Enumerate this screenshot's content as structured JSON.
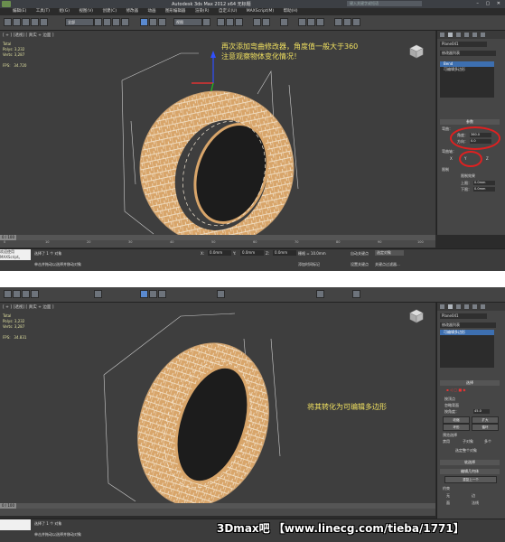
{
  "shot1": {
    "title": "Autodesk 3ds Max 2012 x64   无标题",
    "search_placeholder": "键入关键字或短语",
    "menu": [
      "编辑(E)",
      "工具(T)",
      "组(G)",
      "视图(V)",
      "创建(C)",
      "修改器",
      "动画",
      "图形编辑器",
      "渲染(R)",
      "自定义(U)",
      "MAXScript(M)",
      "帮助(H)"
    ],
    "selection_filter": "全部",
    "view_dropdown": "视图",
    "viewport_label": "[ + ] [透视] [ 真实 + 边面 ]",
    "stats": [
      "Total",
      "Polys: 3,232",
      "Verts: 3,287",
      "",
      "FPS:   34.720"
    ],
    "annotation_line1": "再次添加弯曲修改器，角度值一般大于360",
    "annotation_line2": "注意观察物体变化情况！",
    "object_name": "Plane041",
    "modifier_list": "修改器列表",
    "stack": [
      "Bend",
      "可编辑多边形"
    ],
    "rollout": "参数",
    "bend_label": "弯曲：",
    "angle_label": "角度：",
    "angle_value": "360.0",
    "direction_label": "方向：",
    "direction_value": "0.0",
    "axis_label": "弯曲轴：",
    "axes": [
      "X",
      "Y",
      "Z"
    ],
    "limits_label": "限制",
    "limit_effect": "限制效果",
    "upper_label": "上限：",
    "upper_value": "0.0mm",
    "lower_label": "下限：",
    "lower_value": "0.0mm",
    "time_slider": "0 / 100",
    "ticks": [
      "0",
      "10",
      "20",
      "30",
      "40",
      "50",
      "60",
      "70",
      "80",
      "90",
      "100"
    ],
    "maxscript_label": "欢迎使用 MAXScript。",
    "status_selected": "选择了 1 个 对象",
    "status_prompt": "单击并拖动以选择并移动对象",
    "x_value": "0.0mm",
    "y_value": "0.0mm",
    "z_value": "0.0mm",
    "grid_label": "栅格 = 10.0mm",
    "autokey": "自动关键点",
    "setkey": "设置关键点",
    "selected_dropdown": "选定对象",
    "keyfilter": "关键点过滤器...",
    "add_tag": "添加时间标记"
  },
  "shot2": {
    "viewport_label": "[ + ] [透视] [ 真实 + 边面 ]",
    "stats": [
      "Total",
      "Polys: 3,232",
      "Verts: 3,287",
      "",
      "FPS:   34.831"
    ],
    "annotation": "将其转化为可编辑多边形",
    "object_name": "Plane041",
    "modifier_list": "修改器列表",
    "stack": [
      "可编辑多边形"
    ],
    "selection_rollout": "选择",
    "by_vertex": "按顶点",
    "ignore_backfacing": "忽略背面",
    "by_angle": "按角度：",
    "angle_value": "45.0",
    "shrink": "收缩",
    "grow": "扩大",
    "ring": "环形",
    "loop": "循环",
    "preview_selection": "预览选择",
    "preview_options": [
      "禁用",
      "子对象",
      "多个"
    ],
    "selected_whole": "选定整个对象",
    "soft_selection": "软选择",
    "edit_geometry": "编辑几何体",
    "repeat_last": "重复上一个",
    "constraints": "约束",
    "constraint_options": [
      "无",
      "边",
      "面",
      "法线"
    ],
    "time_slider": "0 / 100",
    "status_selected": "选择了 1 个 对象",
    "status_prompt": "单击并拖动以选择并移动对象"
  },
  "watermark": "3Dmax吧 【www.linecg.com/tieba/1771】",
  "colors": {
    "tire": "#d6a46a",
    "wire": "#f3e6cf",
    "annotation": "#f0e060",
    "highlight": "#3d6fb0",
    "red_circle": "#e02020"
  }
}
